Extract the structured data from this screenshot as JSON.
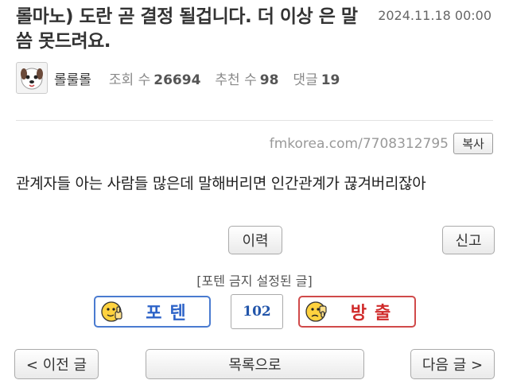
{
  "post": {
    "title": "롤마노) 도란 곧 결정 될겁니다. 더 이상 은 말씀 못드려요.",
    "date": "2024.11.18 00:00",
    "author": "롤룰롤",
    "views_label": "조회 수",
    "views": "26694",
    "recommend_label": "추천 수",
    "recommend": "98",
    "comments_label": "댓글",
    "comments": "19",
    "url": "fmkorea.com/7708312795",
    "copy_label": "복사",
    "content": "관계자들 아는 사람들 많은데 말해버리면 인간관계가 끊겨버리잖아"
  },
  "actions": {
    "history_label": "이력",
    "report_label": "신고",
    "forbidden_text": "[포텐 금지 설정된 글]",
    "upvote_label": "포텐",
    "vote_count": "102",
    "downvote_label": "방출"
  },
  "nav": {
    "prev_label": "< 이전 글",
    "list_label": "목록으로",
    "next_label": "다음 글 >"
  },
  "icons": {
    "avatar": "dog-avatar-icon",
    "upvote": "thumbs-up-face-icon",
    "downvote": "thumbs-down-face-icon"
  },
  "colors": {
    "upvote_border": "#4a7bd0",
    "downvote_border": "#d04a4a",
    "vote_count": "#2255aa"
  }
}
